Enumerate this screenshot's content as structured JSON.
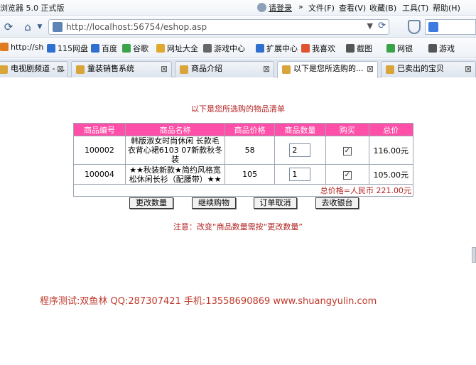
{
  "browser": {
    "title": "浏览器 5.0 正式版",
    "menu": {
      "login": "请登录",
      "more": "»",
      "file": "文件(F)",
      "view": "查看(V)",
      "favorites": "收藏(B)",
      "tools": "工具(T)",
      "help": "帮助(H)"
    },
    "address": "http://localhost:56754/eshop.asp",
    "bookmarks": [
      {
        "label": "http://sh",
        "color": "#e07a1f"
      },
      {
        "label": "115网盘",
        "color": "#2f6fd0"
      },
      {
        "label": "百度",
        "color": "#2f6fd0"
      },
      {
        "label": "谷歌",
        "color": "#3aa34a"
      },
      {
        "label": "网址大全",
        "color": "#e0a82e"
      },
      {
        "label": "游戏中心",
        "color": "#666666"
      },
      {
        "label": "扩展中心",
        "color": "#2f6fd0"
      },
      {
        "label": "我喜欢",
        "color": "#e0532e"
      },
      {
        "label": "截图",
        "color": "#555555"
      },
      {
        "label": "网银",
        "color": "#3aa34a"
      },
      {
        "label": "游戏",
        "color": "#555555"
      }
    ],
    "tabs": [
      {
        "label": "电视剧频道 - ..."
      },
      {
        "label": "童装销售系统"
      },
      {
        "label": "商品介绍"
      },
      {
        "label": "以下是您所选购的..."
      },
      {
        "label": "已卖出的宝贝"
      }
    ]
  },
  "page": {
    "heading": "以下是您所选购的物品清单",
    "columns": [
      "商品编号",
      "商品名称",
      "商品价格",
      "商品数量",
      "购买",
      "总价"
    ],
    "rows": [
      {
        "id": "100002",
        "name": "韩版淑女时尚休闲 长款毛衣背心裙6103 07新款秋冬装",
        "price": "58",
        "qty": "2",
        "buy": true,
        "total": "116.00元"
      },
      {
        "id": "100004",
        "name": "★★秋装新款★简约风格宽松休闲长衫（配腰带）★★",
        "price": "105",
        "qty": "1",
        "buy": true,
        "total": "105.00元"
      }
    ],
    "grand_total": "总价格=人民币  221.00元",
    "buttons": {
      "update": "更改数量",
      "continue": "继续购物",
      "cancel": "订单取消",
      "checkout": "去收银台"
    },
    "note": "注意：改变“商品数量需按“更改数量”",
    "footer": "程序测试:双鱼林 QQ:287307421 手机:13558690869 www.shuangyulin.com"
  }
}
